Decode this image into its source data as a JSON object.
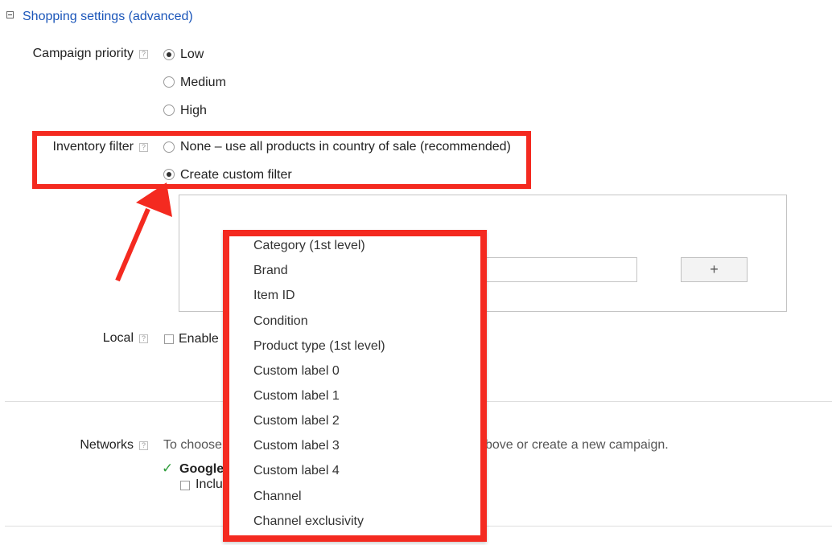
{
  "section": {
    "title": "Shopping settings (advanced)"
  },
  "campaign_priority": {
    "label": "Campaign priority",
    "help": "?",
    "options": [
      {
        "label": "Low",
        "selected": true
      },
      {
        "label": "Medium",
        "selected": false
      },
      {
        "label": "High",
        "selected": false
      }
    ]
  },
  "inventory_filter": {
    "label": "Inventory filter",
    "help": "?",
    "options": [
      {
        "label": "None – use all products in country of sale (recommended)",
        "selected": false
      },
      {
        "label": "Create custom filter",
        "selected": true
      }
    ],
    "add_button": "+"
  },
  "dropdown": {
    "items": [
      "Category (1st level)",
      "Brand",
      "Item ID",
      "Condition",
      "Product type (1st level)",
      "Custom label 0",
      "Custom label 1",
      "Custom label 2",
      "Custom label 3",
      "Custom label 4",
      "Channel",
      "Channel exclusivity"
    ]
  },
  "local": {
    "label": "Local",
    "help": "?",
    "checkbox_label_visible": "Enable"
  },
  "networks": {
    "label": "Networks",
    "help": "?",
    "text_visible_left": "To choose",
    "text_visible_right": "bove or create a new campaign.",
    "network_name_visible": "Google",
    "include_label_visible": "Inclu",
    "check_glyph": "✓"
  },
  "colors": {
    "link": "#1a55b9",
    "highlight": "#f42a20",
    "check": "#2e9d3a"
  }
}
